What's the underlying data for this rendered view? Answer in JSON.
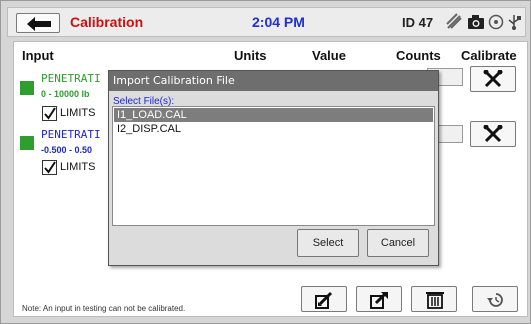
{
  "topbar": {
    "title": "Calibration",
    "time": "2:04 PM",
    "id_label": "ID 47"
  },
  "headers": {
    "input": "Input",
    "units": "Units",
    "value": "Value",
    "counts": "Counts",
    "calibrate": "Calibrate"
  },
  "channels": [
    {
      "name": "PENETRATI",
      "range": "0 - 10000 lb",
      "name_color": "#2e9e2e",
      "range_color": "#2e9e2e",
      "limits_label": "LIMITS",
      "limits_checked": true
    },
    {
      "name": "PENETRATI",
      "range": "-0.500 - 0.50",
      "name_color": "#1d28c9",
      "range_color": "#1d28c9",
      "limits_label": "LIMITS",
      "limits_checked": true
    }
  ],
  "dialog": {
    "title": "Import Calibration File",
    "subtitle": "Select File(s):",
    "files": [
      {
        "name": "I1_LOAD.CAL",
        "selected": true
      },
      {
        "name": "I2_DISP.CAL",
        "selected": false
      }
    ],
    "select_label": "Select",
    "cancel_label": "Cancel"
  },
  "note": "Note:  An input in testing can not be calibrated.",
  "icons": {
    "back": "back-arrow-icon",
    "status": [
      "usb-disconnected-icon",
      "camera-icon",
      "network-icon",
      "usb-icon"
    ],
    "calibrate": "wrench-icon",
    "toolbar": [
      "import-icon",
      "export-icon",
      "delete-icon",
      "restore-icon"
    ]
  },
  "colors": {
    "title": "#cc1010",
    "clock": "#1f2fd6",
    "channel_swatch": "#2e9e2e",
    "dialog_titlebar": "#6e6e6e",
    "selection": "#7d7d7d"
  }
}
